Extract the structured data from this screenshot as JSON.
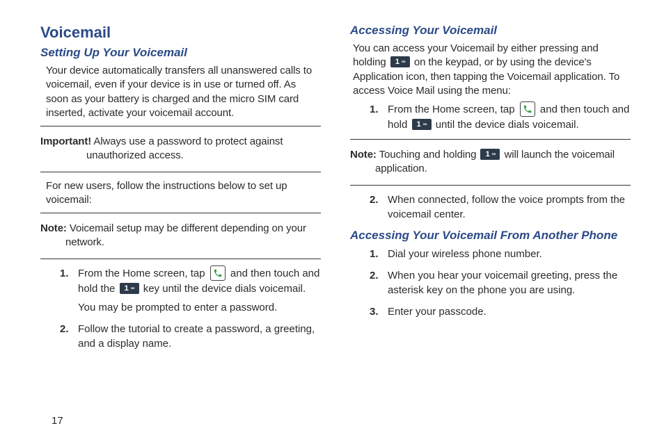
{
  "page_number": "17",
  "left": {
    "h1": "Voicemail",
    "h2a": "Setting Up Your Voicemail",
    "intro": "Your device automatically transfers all unanswered calls to voicemail, even if your device is in use or turned off. As soon as your battery is charged and the micro SIM card inserted, activate your voicemail account.",
    "important_label": "Important!",
    "important_text": "Always use a password to protect against unauthorized access.",
    "new_users": "For new users, follow the instructions below to set up voicemail:",
    "note_label": "Note:",
    "note_text": "Voicemail setup may be different depending on your network.",
    "steps": [
      {
        "n": "1.",
        "a": "From the Home screen, tap ",
        "b": " and then touch and hold the ",
        "c": " key until the device dials voicemail.",
        "d": "You may be prompted to enter a password."
      },
      {
        "n": "2.",
        "a": "Follow the tutorial to create a password, a greeting, and a display name."
      }
    ]
  },
  "right": {
    "h2a": "Accessing Your Voicemail",
    "intro_a": "You can access your Voicemail by either pressing and holding ",
    "intro_b": " on the keypad, or by using the device's Application icon, then tapping the Voicemail application. To access Voice Mail using the menu:",
    "steps1": [
      {
        "n": "1.",
        "a": "From the Home screen, tap ",
        "b": " and then touch and hold ",
        "c": " until the device dials voicemail."
      }
    ],
    "note_label": "Note:",
    "note_a": "Touching and holding ",
    "note_b": " will launch the voicemail application.",
    "steps2": [
      {
        "n": "2.",
        "a": "When connected, follow the voice prompts from the voicemail center."
      }
    ],
    "h2b": "Accessing Your Voicemail From Another Phone",
    "steps3": [
      {
        "n": "1.",
        "a": "Dial your wireless phone number."
      },
      {
        "n": "2.",
        "a": "When you hear your voicemail greeting, press the asterisk key on the phone you are using."
      },
      {
        "n": "3.",
        "a": "Enter your passcode."
      }
    ]
  },
  "icons": {
    "key1": {
      "digit": "1",
      "sym": "∞"
    },
    "phone": "phone-icon"
  }
}
